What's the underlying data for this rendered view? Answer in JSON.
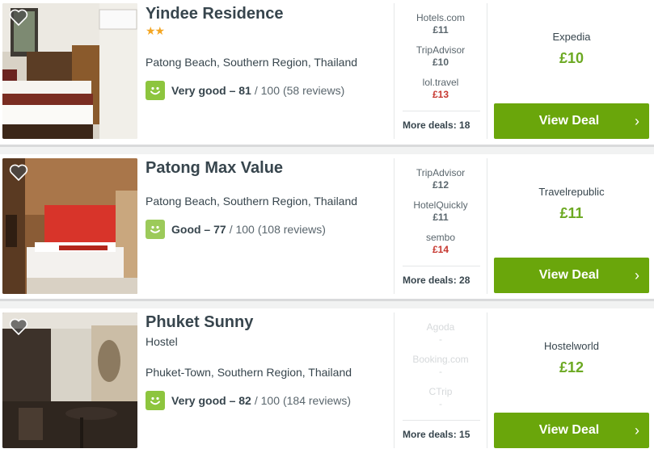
{
  "results": [
    {
      "name": "Yindee Residence",
      "stars": "★★",
      "type": "",
      "location": "Patong Beach, Southern Region, Thailand",
      "rating": {
        "label": "Very good",
        "score": "81",
        "scale": "/ 100",
        "reviews": "(58 reviews)"
      },
      "deals": [
        {
          "site": "Hotels.com",
          "price": "£11",
          "highlight": false
        },
        {
          "site": "TripAdvisor",
          "price": "£10",
          "highlight": false
        },
        {
          "site": "lol.travel",
          "price": "£13",
          "highlight": true
        }
      ],
      "more_deals": "More deals: 18",
      "best_site": "Expedia",
      "best_price": "£10",
      "cta": "View Deal"
    },
    {
      "name": "Patong Max Value",
      "stars": "",
      "type": "",
      "location": "Patong Beach, Southern Region, Thailand",
      "rating": {
        "label": "Good",
        "score": "77",
        "scale": "/ 100",
        "reviews": "(108 reviews)"
      },
      "deals": [
        {
          "site": "TripAdvisor",
          "price": "£12",
          "highlight": false
        },
        {
          "site": "HotelQuickly",
          "price": "£11",
          "highlight": false
        },
        {
          "site": "sembo",
          "price": "£14",
          "highlight": true
        }
      ],
      "more_deals": "More deals: 28",
      "best_site": "Travelrepublic",
      "best_price": "£11",
      "cta": "View Deal"
    },
    {
      "name": "Phuket Sunny",
      "stars": "",
      "type": "Hostel",
      "location": "Phuket-Town, Southern Region, Thailand",
      "rating": {
        "label": "Very good",
        "score": "82",
        "scale": "/ 100",
        "reviews": "(184 reviews)"
      },
      "deals": [
        {
          "site": "Agoda",
          "price": "-",
          "highlight": false
        },
        {
          "site": "Booking.com",
          "price": "-",
          "highlight": false
        },
        {
          "site": "CTrip",
          "price": "-",
          "highlight": false
        }
      ],
      "more_deals": "More deals: 15",
      "best_site": "Hostelworld",
      "best_price": "£12",
      "cta": "View Deal"
    }
  ],
  "icons": {
    "favorite": "heart-icon",
    "rating": "smiley-icon",
    "cta": "chevron-right-icon"
  },
  "colors": {
    "cta_green": "#6aa60b",
    "price_green": "#6ca922",
    "price_red": "#c6372f",
    "rating_green": "#8dc53e",
    "star_gold": "#f4a623"
  }
}
